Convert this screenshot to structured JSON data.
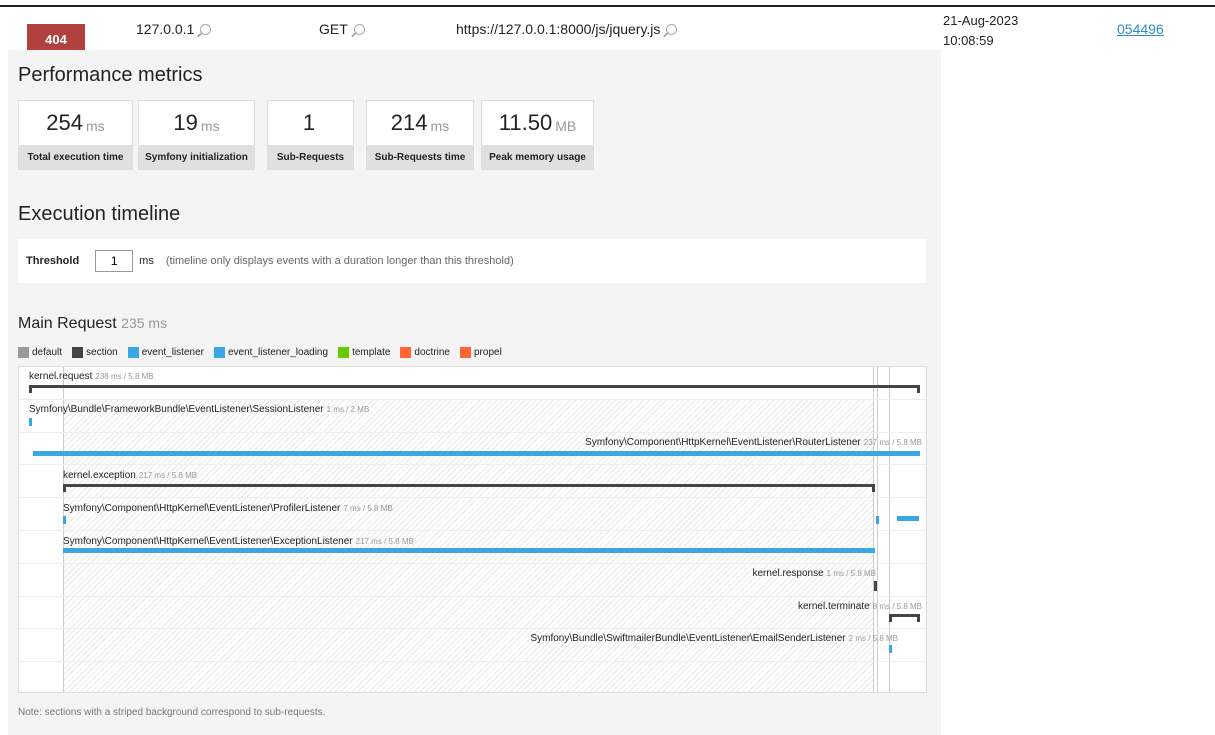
{
  "header": {
    "status_code": "404",
    "ip": "127.0.0.1",
    "method": "GET",
    "url": "https://127.0.0.1:8000/js/jquery.js",
    "date": "21-Aug-2023",
    "time": "10:08:59",
    "token": "054496"
  },
  "performance": {
    "title": "Performance metrics",
    "metrics": [
      {
        "value": "254",
        "unit": "ms",
        "label": "Total execution time"
      },
      {
        "value": "19",
        "unit": "ms",
        "label": "Symfony initialization"
      },
      {
        "value": "1",
        "unit": "",
        "label": "Sub-Requests"
      },
      {
        "value": "214",
        "unit": "ms",
        "label": "Sub-Requests time"
      },
      {
        "value": "11.50",
        "unit": "MB",
        "label": "Peak memory usage"
      }
    ]
  },
  "timeline": {
    "title": "Execution timeline",
    "threshold_label": "Threshold",
    "threshold_value": "1",
    "threshold_unit": "ms",
    "threshold_hint": "(timeline only displays events with a duration longer than this threshold)",
    "main_request_title": "Main Request",
    "main_request_duration": "235 ms",
    "legend": [
      {
        "name": "default",
        "color": "#999999"
      },
      {
        "name": "section",
        "color": "#444444"
      },
      {
        "name": "event_listener",
        "color": "#3aa6e4"
      },
      {
        "name": "event_listener_loading",
        "color": "#3aa6e4"
      },
      {
        "name": "template",
        "color": "#66cc00"
      },
      {
        "name": "doctrine",
        "color": "#ff6633"
      },
      {
        "name": "propel",
        "color": "#ff6633"
      }
    ],
    "events": [
      {
        "name": "kernel.request",
        "meta": "238 ms / 5.8 MB"
      },
      {
        "name": "Symfony\\Bundle\\FrameworkBundle\\EventListener\\SessionListener",
        "meta": "1 ms / 2 MB"
      },
      {
        "name": "Symfony\\Component\\HttpKernel\\EventListener\\RouterListener",
        "meta": "237 ms / 5.8 MB"
      },
      {
        "name": "kernel.exception",
        "meta": "217 ms / 5.8 MB"
      },
      {
        "name": "Symfony\\Component\\HttpKernel\\EventListener\\ProfilerListener",
        "meta": "7 ms / 5.8 MB"
      },
      {
        "name": "Symfony\\Component\\HttpKernel\\EventListener\\ExceptionListener",
        "meta": "217 ms / 5.8 MB"
      },
      {
        "name": "kernel.response",
        "meta": "1 ms / 5.8 MB"
      },
      {
        "name": "kernel.terminate",
        "meta": "8 ms / 5.8 MB"
      },
      {
        "name": "Symfony\\Bundle\\SwiftmailerBundle\\EventListener\\EmailSenderListener",
        "meta": "2 ms / 5.8 MB"
      }
    ],
    "note": "Note: sections with a striped background correspond to sub-requests."
  }
}
